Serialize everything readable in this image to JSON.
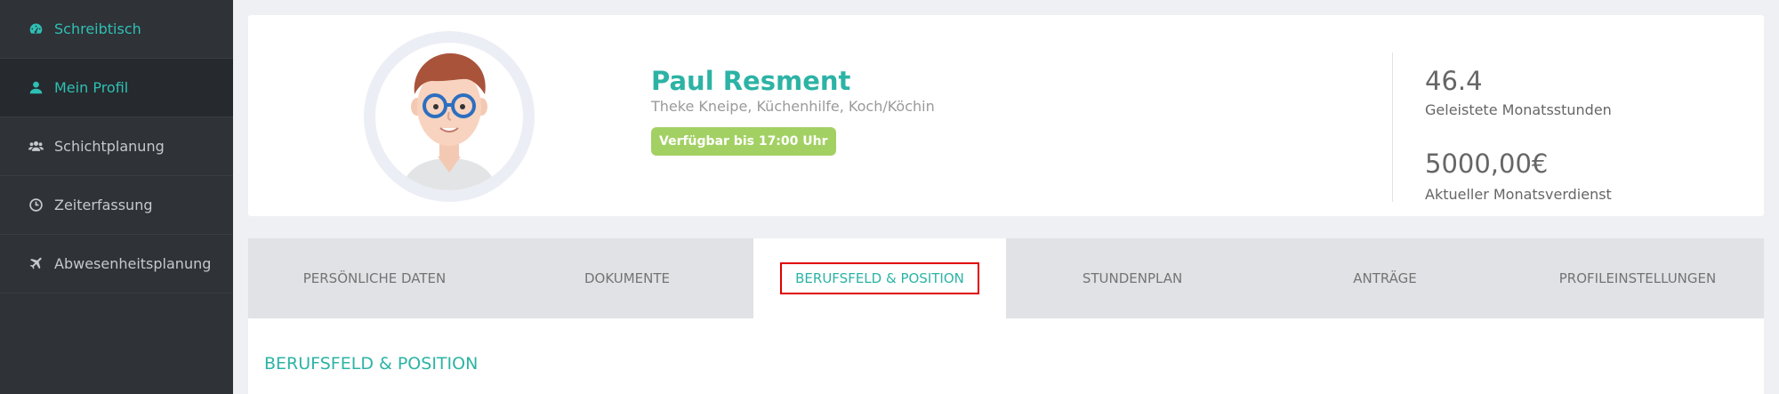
{
  "sidebar": {
    "items": [
      {
        "label": "Schreibtisch",
        "icon": "dashboard-icon"
      },
      {
        "label": "Mein Profil",
        "icon": "user-icon"
      },
      {
        "label": "Schichtplanung",
        "icon": "users-icon"
      },
      {
        "label": "Zeiterfassung",
        "icon": "clock-icon"
      },
      {
        "label": "Abwesenheitsplanung",
        "icon": "plane-icon"
      }
    ]
  },
  "profile": {
    "name": "Paul Resment",
    "roles": "Theke Kneipe, Küchenhilfe, Koch/Köchin",
    "availability": "Verfügbar bis 17:00 Uhr"
  },
  "stats": {
    "hours_value": "46.4",
    "hours_label": "Geleistete Monatsstunden",
    "earnings_value": "5000,00€",
    "earnings_label": "Aktueller Monatsverdienst"
  },
  "tabs": [
    {
      "label": "PERSÖNLICHE DATEN"
    },
    {
      "label": "DOKUMENTE"
    },
    {
      "label": "BERUFSFELD & POSITION"
    },
    {
      "label": "STUNDENPLAN"
    },
    {
      "label": "ANTRÄGE"
    },
    {
      "label": "PROFILEINSTELLUNGEN"
    }
  ],
  "content": {
    "section_title": "BERUFSFELD & POSITION"
  },
  "colors": {
    "accent": "#2cb3a5",
    "sidebar_bg": "#2f3237",
    "badge_bg": "#a3d063",
    "highlight_border": "#e00000"
  }
}
